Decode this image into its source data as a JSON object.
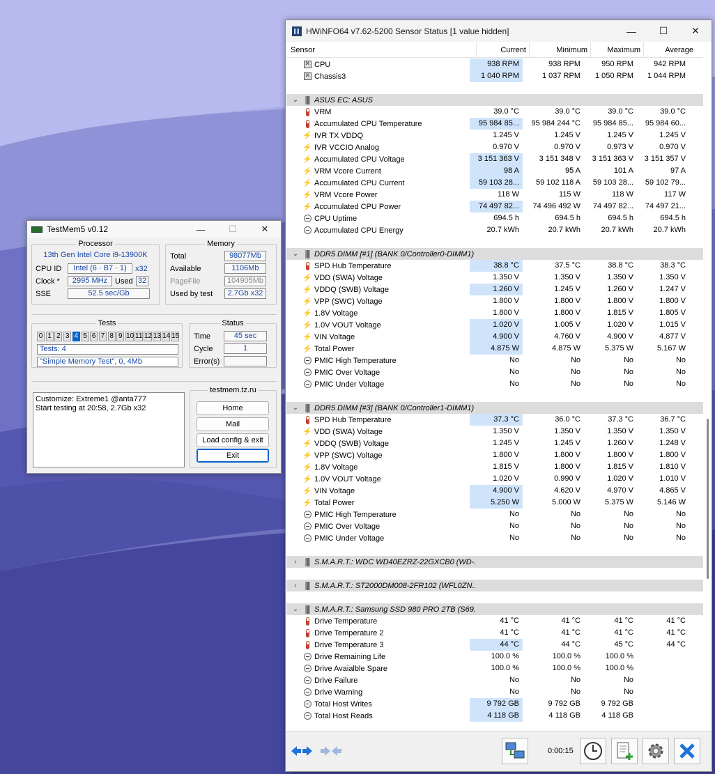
{
  "hwinfo": {
    "title": "HWiNFO64 v7.62-5200 Sensor Status [1 value hidden]",
    "columns": [
      "Sensor",
      "Current",
      "Minimum",
      "Maximum",
      "Average"
    ],
    "timer": "0:00:15",
    "rows": [
      {
        "kind": "sensor",
        "icon": "fan",
        "label": "CPU",
        "v": [
          "938 RPM",
          "938 RPM",
          "950 RPM",
          "942 RPM"
        ],
        "hl": true
      },
      {
        "kind": "sensor",
        "icon": "fan",
        "label": "Chassis3",
        "v": [
          "1 040 RPM",
          "1 037 RPM",
          "1 050 RPM",
          "1 044 RPM"
        ],
        "hl": true
      },
      {
        "kind": "blank"
      },
      {
        "kind": "group",
        "label": "ASUS EC: ASUS",
        "exp": "⌄"
      },
      {
        "kind": "sensor",
        "icon": "therm",
        "label": "VRM",
        "v": [
          "39.0 °C",
          "39.0 °C",
          "39.0 °C",
          "39.0 °C"
        ],
        "hl": false
      },
      {
        "kind": "sensor",
        "icon": "therm",
        "label": "Accumulated CPU Temperature",
        "v": [
          "95 984 85...",
          "95 984 244 °C",
          "95 984 85...",
          "95 984 60..."
        ],
        "hl": true
      },
      {
        "kind": "sensor",
        "icon": "bolt",
        "label": "IVR TX VDDQ",
        "v": [
          "1.245 V",
          "1.245 V",
          "1.245 V",
          "1.245 V"
        ],
        "hl": false
      },
      {
        "kind": "sensor",
        "icon": "bolt",
        "label": "IVR VCCIO Analog",
        "v": [
          "0.970 V",
          "0.970 V",
          "0.973 V",
          "0.970 V"
        ],
        "hl": false
      },
      {
        "kind": "sensor",
        "icon": "bolt",
        "label": "Accumulated CPU Voltage",
        "v": [
          "3 151 363 V",
          "3 151 348 V",
          "3 151 363 V",
          "3 151 357 V"
        ],
        "hl": true
      },
      {
        "kind": "sensor",
        "icon": "bolt",
        "label": "VRM Vcore Current",
        "v": [
          "98 A",
          "95 A",
          "101 A",
          "97 A"
        ],
        "hl": true
      },
      {
        "kind": "sensor",
        "icon": "bolt",
        "label": "Accumulated CPU Current",
        "v": [
          "59 103 28...",
          "59 102 118 A",
          "59 103 28...",
          "59 102 79..."
        ],
        "hl": true
      },
      {
        "kind": "sensor",
        "icon": "bolt",
        "label": "VRM Vcore Power",
        "v": [
          "118 W",
          "115 W",
          "118 W",
          "117 W"
        ],
        "hl": false
      },
      {
        "kind": "sensor",
        "icon": "bolt",
        "label": "Accumulated CPU Power",
        "v": [
          "74 497 82...",
          "74 496 492 W",
          "74 497 82...",
          "74 497 21..."
        ],
        "hl": true
      },
      {
        "kind": "sensor",
        "icon": "clock",
        "label": "CPU Uptime",
        "v": [
          "694.5 h",
          "694.5 h",
          "694.5 h",
          "694.5 h"
        ],
        "hl": false
      },
      {
        "kind": "sensor",
        "icon": "clock",
        "label": "Accumulated CPU Energy",
        "v": [
          "20.7 kWh",
          "20.7 kWh",
          "20.7 kWh",
          "20.7 kWh"
        ],
        "hl": false
      },
      {
        "kind": "blank"
      },
      {
        "kind": "group",
        "label": "DDR5 DIMM [#1] (BANK 0/Controller0-DIMM1)",
        "exp": "⌄"
      },
      {
        "kind": "sensor",
        "icon": "therm",
        "label": "SPD Hub Temperature",
        "v": [
          "38.8 °C",
          "37.5 °C",
          "38.8 °C",
          "38.3 °C"
        ],
        "hl": true
      },
      {
        "kind": "sensor",
        "icon": "bolt",
        "label": "VDD (SWA) Voltage",
        "v": [
          "1.350 V",
          "1.350 V",
          "1.350 V",
          "1.350 V"
        ],
        "hl": false
      },
      {
        "kind": "sensor",
        "icon": "bolt",
        "label": "VDDQ (SWB) Voltage",
        "v": [
          "1.260 V",
          "1.245 V",
          "1.260 V",
          "1.247 V"
        ],
        "hl": true
      },
      {
        "kind": "sensor",
        "icon": "bolt",
        "label": "VPP (SWC) Voltage",
        "v": [
          "1.800 V",
          "1.800 V",
          "1.800 V",
          "1.800 V"
        ],
        "hl": false
      },
      {
        "kind": "sensor",
        "icon": "bolt",
        "label": "1.8V Voltage",
        "v": [
          "1.800 V",
          "1.800 V",
          "1.815 V",
          "1.805 V"
        ],
        "hl": false
      },
      {
        "kind": "sensor",
        "icon": "bolt",
        "label": "1.0V VOUT Voltage",
        "v": [
          "1.020 V",
          "1.005 V",
          "1.020 V",
          "1.015 V"
        ],
        "hl": true
      },
      {
        "kind": "sensor",
        "icon": "bolt",
        "label": "VIN Voltage",
        "v": [
          "4.900 V",
          "4.760 V",
          "4.900 V",
          "4.877 V"
        ],
        "hl": true
      },
      {
        "kind": "sensor",
        "icon": "bolt",
        "label": "Total Power",
        "v": [
          "4.875 W",
          "4.875 W",
          "5.375 W",
          "5.167 W"
        ],
        "hl": true
      },
      {
        "kind": "sensor",
        "icon": "clock",
        "label": "PMIC High Temperature",
        "v": [
          "No",
          "No",
          "No",
          "No"
        ],
        "hl": false
      },
      {
        "kind": "sensor",
        "icon": "clock",
        "label": "PMIC Over Voltage",
        "v": [
          "No",
          "No",
          "No",
          "No"
        ],
        "hl": false
      },
      {
        "kind": "sensor",
        "icon": "clock",
        "label": "PMIC Under Voltage",
        "v": [
          "No",
          "No",
          "No",
          "No"
        ],
        "hl": false
      },
      {
        "kind": "blank"
      },
      {
        "kind": "group",
        "label": "DDR5 DIMM [#3] (BANK 0/Controller1-DIMM1)",
        "exp": "⌄"
      },
      {
        "kind": "sensor",
        "icon": "therm",
        "label": "SPD Hub Temperature",
        "v": [
          "37.3 °C",
          "36.0 °C",
          "37.3 °C",
          "36.7 °C"
        ],
        "hl": true
      },
      {
        "kind": "sensor",
        "icon": "bolt",
        "label": "VDD (SWA) Voltage",
        "v": [
          "1.350 V",
          "1.350 V",
          "1.350 V",
          "1.350 V"
        ],
        "hl": false
      },
      {
        "kind": "sensor",
        "icon": "bolt",
        "label": "VDDQ (SWB) Voltage",
        "v": [
          "1.245 V",
          "1.245 V",
          "1.260 V",
          "1.248 V"
        ],
        "hl": false
      },
      {
        "kind": "sensor",
        "icon": "bolt",
        "label": "VPP (SWC) Voltage",
        "v": [
          "1.800 V",
          "1.800 V",
          "1.800 V",
          "1.800 V"
        ],
        "hl": false
      },
      {
        "kind": "sensor",
        "icon": "bolt",
        "label": "1.8V Voltage",
        "v": [
          "1.815 V",
          "1.800 V",
          "1.815 V",
          "1.810 V"
        ],
        "hl": false
      },
      {
        "kind": "sensor",
        "icon": "bolt",
        "label": "1.0V VOUT Voltage",
        "v": [
          "1.020 V",
          "0.990 V",
          "1.020 V",
          "1.010 V"
        ],
        "hl": false
      },
      {
        "kind": "sensor",
        "icon": "bolt",
        "label": "VIN Voltage",
        "v": [
          "4.900 V",
          "4.620 V",
          "4.970 V",
          "4.865 V"
        ],
        "hl": true
      },
      {
        "kind": "sensor",
        "icon": "bolt",
        "label": "Total Power",
        "v": [
          "5.250 W",
          "5.000 W",
          "5.375 W",
          "5.146 W"
        ],
        "hl": true
      },
      {
        "kind": "sensor",
        "icon": "clock",
        "label": "PMIC High Temperature",
        "v": [
          "No",
          "No",
          "No",
          "No"
        ],
        "hl": false
      },
      {
        "kind": "sensor",
        "icon": "clock",
        "label": "PMIC Over Voltage",
        "v": [
          "No",
          "No",
          "No",
          "No"
        ],
        "hl": false
      },
      {
        "kind": "sensor",
        "icon": "clock",
        "label": "PMIC Under Voltage",
        "v": [
          "No",
          "No",
          "No",
          "No"
        ],
        "hl": false
      },
      {
        "kind": "blank"
      },
      {
        "kind": "group",
        "label": "S.M.A.R.T.: WDC WD40EZRZ-22GXCB0 (WD-...",
        "exp": "›"
      },
      {
        "kind": "blank"
      },
      {
        "kind": "group",
        "label": "S.M.A.R.T.: ST2000DM008-2FR102 (WFL0ZN...",
        "exp": "›"
      },
      {
        "kind": "blank"
      },
      {
        "kind": "group",
        "label": "S.M.A.R.T.: Samsung SSD 980 PRO 2TB (S69...",
        "exp": "⌄"
      },
      {
        "kind": "sensor",
        "icon": "therm",
        "label": "Drive Temperature",
        "v": [
          "41 °C",
          "41 °C",
          "41 °C",
          "41 °C"
        ],
        "hl": false
      },
      {
        "kind": "sensor",
        "icon": "therm",
        "label": "Drive Temperature 2",
        "v": [
          "41 °C",
          "41 °C",
          "41 °C",
          "41 °C"
        ],
        "hl": false
      },
      {
        "kind": "sensor",
        "icon": "therm",
        "label": "Drive Temperature 3",
        "v": [
          "44 °C",
          "44 °C",
          "45 °C",
          "44 °C"
        ],
        "hl": true
      },
      {
        "kind": "sensor",
        "icon": "clock",
        "label": "Drive Remaining Life",
        "v": [
          "100.0 %",
          "100.0 %",
          "100.0 %",
          ""
        ],
        "hl": false
      },
      {
        "kind": "sensor",
        "icon": "clock",
        "label": "Drive Avaialble Spare",
        "v": [
          "100.0 %",
          "100.0 %",
          "100.0 %",
          ""
        ],
        "hl": false
      },
      {
        "kind": "sensor",
        "icon": "clock",
        "label": "Drive Failure",
        "v": [
          "No",
          "No",
          "No",
          ""
        ],
        "hl": false
      },
      {
        "kind": "sensor",
        "icon": "clock",
        "label": "Drive Warning",
        "v": [
          "No",
          "No",
          "No",
          ""
        ],
        "hl": false
      },
      {
        "kind": "sensor",
        "icon": "clock",
        "label": "Total Host Writes",
        "v": [
          "9 792 GB",
          "9 792 GB",
          "9 792 GB",
          ""
        ],
        "hl": true
      },
      {
        "kind": "sensor",
        "icon": "clock",
        "label": "Total Host Reads",
        "v": [
          "4 118 GB",
          "4 118 GB",
          "4 118 GB",
          ""
        ],
        "hl": true
      }
    ]
  },
  "testmem": {
    "title": "TestMem5 v0.12",
    "processor": {
      "legend": "Processor",
      "name": "13th Gen Intel Core i9-13900K",
      "cpuid_label": "CPU ID",
      "cpuid_value": "Intel  (6 · B7 · 1)",
      "threads": "x32",
      "clock_label": "Clock *",
      "clock_value": "2995 MHz",
      "used_label": "Used",
      "used_value": "32",
      "sse_label": "SSE",
      "sse_value": "52.5 sec/Gb"
    },
    "memory": {
      "legend": "Memory",
      "total_label": "Total",
      "total_value": "98077Mb",
      "available_label": "Available",
      "available_value": "1106Mb",
      "pagefile_label": "PageFile",
      "pagefile_value": "104905Mb",
      "usedbytest_label": "Used by test",
      "usedbytest_value": "2.7Gb x32"
    },
    "tests": {
      "legend": "Tests",
      "numbers": [
        "0",
        "1",
        "2",
        "3",
        "4",
        "5",
        "6",
        "7",
        "8",
        "9",
        "10",
        "11",
        "12",
        "13",
        "14",
        "15"
      ],
      "active": "4",
      "count": "Tests: 4",
      "current": "\"Simple Memory Test\", 0, 4Mb"
    },
    "status": {
      "legend": "Status",
      "time_label": "Time",
      "time_value": "45 sec",
      "cycle_label": "Cycle",
      "cycle_value": "1",
      "errors_label": "Error(s)",
      "errors_value": ""
    },
    "log": [
      "Customize: Extreme1 @anta777",
      "Start testing at 20:58, 2.7Gb x32"
    ],
    "site": "testmem.tz.ru",
    "buttons": {
      "home": "Home",
      "mail": "Mail",
      "load": "Load config & exit",
      "exit": "Exit"
    }
  },
  "colors": {
    "highlight": "#cfe4fb",
    "accent": "#0a64c8",
    "value_blue": "#1a47a5"
  }
}
